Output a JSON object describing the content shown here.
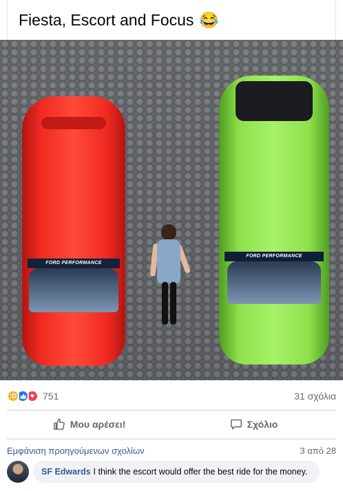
{
  "post": {
    "text": "Fiesta, Escort and Focus",
    "emoji": "😂",
    "photo": {
      "red_car_banner": "FORD PERFORMANCE",
      "green_car_banner": "FORD PERFORMANCE"
    }
  },
  "stats": {
    "reaction_icons": [
      "haha-icon",
      "like-icon",
      "love-icon"
    ],
    "reaction_count": "751",
    "comment_count": "31 σχόλια"
  },
  "actions": {
    "like_label": "Μου αρέσει!",
    "comment_label": "Σχόλιο"
  },
  "comments": {
    "view_previous": "Εμφάνιση προηγούμενων σχολίων",
    "counter": "3 από 28",
    "items": [
      {
        "author": "SF Edwards",
        "text": "I think the escort would offer the best ride for the money."
      }
    ]
  },
  "colors": {
    "link": "#385898",
    "muted": "#65676b",
    "like_blue": "#1877f2",
    "haha_yellow": "#f7b125",
    "love_red": "#f33e58"
  }
}
